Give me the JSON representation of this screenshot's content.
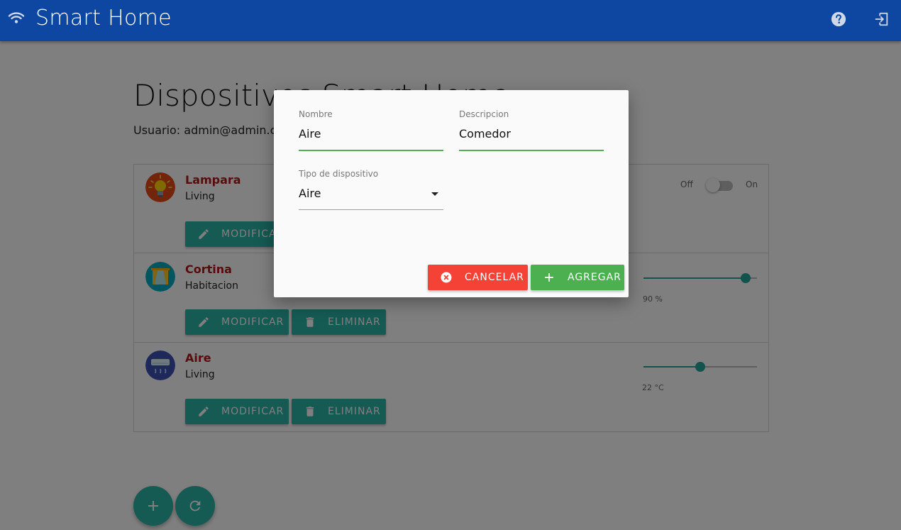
{
  "app": {
    "title": "Smart Home"
  },
  "header": {
    "page_title": "Dispositivos Smart Home",
    "user_line": "Usuario: admin@admin.com"
  },
  "devices": [
    {
      "name": "Lampara",
      "description": "Living",
      "control": "toggle",
      "toggle_off": "Off",
      "toggle_on": "On",
      "state": false
    },
    {
      "name": "Cortina",
      "description": "Habitacion",
      "control": "slider",
      "slider_fraction": 0.9,
      "slider_label": "90 %"
    },
    {
      "name": "Aire",
      "description": "Living",
      "control": "slider",
      "slider_fraction": 0.5,
      "slider_label": "22 °C"
    }
  ],
  "buttons": {
    "modify": "MODIFICAR",
    "delete": "ELIMINAR"
  },
  "fab": {
    "add_icon": "plus-icon",
    "refresh_icon": "refresh-icon"
  },
  "dialog": {
    "nombre_label": "Nombre",
    "nombre_value": "Aire",
    "descripcion_label": "Descripcion",
    "descripcion_value": "Comedor",
    "tipo_label": "Tipo de dispositivo",
    "tipo_value": "Aire",
    "cancel_label": "CANCELAR",
    "add_label": "AGREGAR"
  },
  "colors": {
    "appbar": "#0d47a1",
    "teal": "#2bb5a6",
    "red": "#f44336",
    "green": "#4caf50",
    "device_name": "#b0191b"
  }
}
